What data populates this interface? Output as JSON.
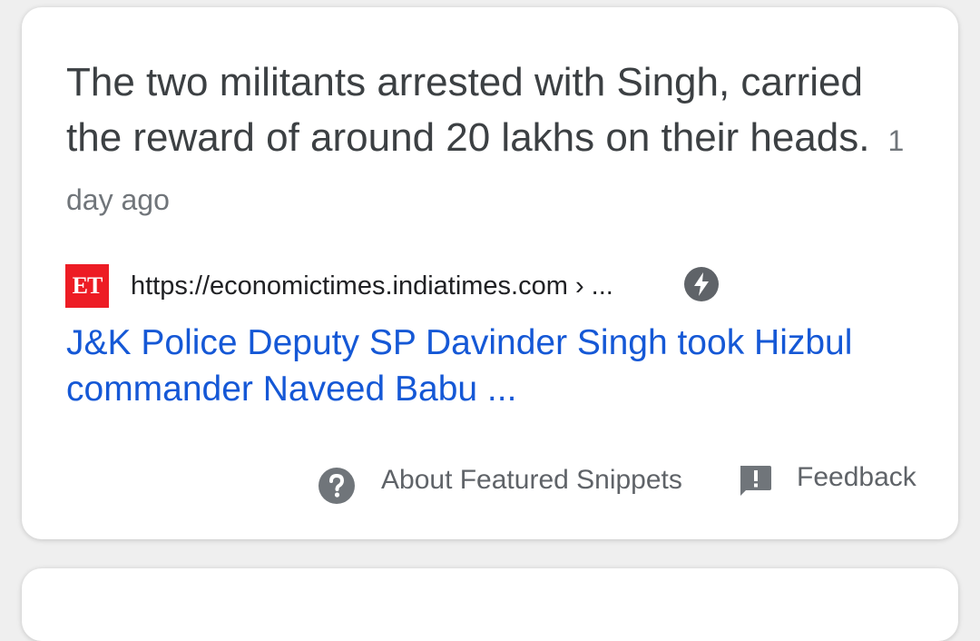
{
  "snippet": {
    "text": "The two militants arrested with Singh, carried the reward of around 20 lakhs on their heads.",
    "date": "1 day ago"
  },
  "source": {
    "favicon_text": "ET",
    "favicon_color": "#ed1c24",
    "url": "https://economictimes.indiatimes.com › ...",
    "amp_icon": "amp-bolt-icon"
  },
  "result": {
    "title": "J&K Police Deputy SP Davinder Singh took Hizbul commander Naveed Babu ...",
    "link_color": "#1558d6"
  },
  "footer": {
    "about_label": "About Featured Snippets",
    "about_icon": "help-circle-icon",
    "feedback_label": "Feedback",
    "feedback_icon": "feedback-icon"
  }
}
